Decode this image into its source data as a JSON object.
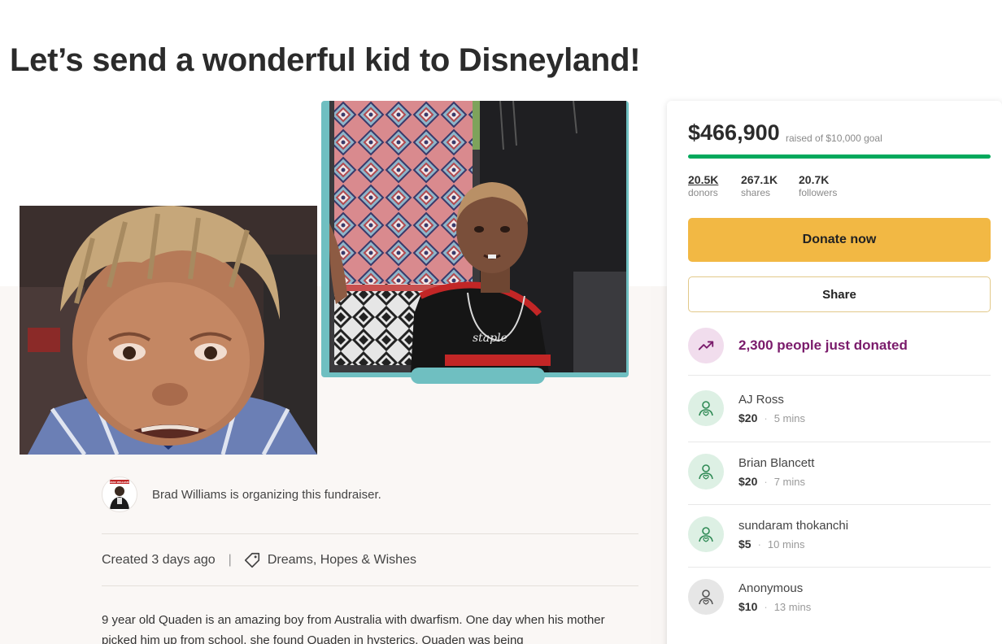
{
  "page": {
    "title": "Let’s send a wonderful kid to Disneyland!"
  },
  "organizer": {
    "avatar_lettering": "BRAD WILLIAMS",
    "text": "Brad Williams is organizing this fundraiser."
  },
  "meta": {
    "created": "Created 3 days ago",
    "separator": "|",
    "category": "Dreams, Hopes & Wishes"
  },
  "story": {
    "text": "9 year old Quaden is an amazing boy from Australia with dwarfism. One day when his mother picked him up from school, she found Quaden in hysterics. Quaden was being"
  },
  "photos": {
    "shirt_lettering": "staple"
  },
  "sidebar": {
    "raised": "$466,900",
    "goal_text": "raised of $10,000 goal",
    "progress_fraction": 1.0,
    "stats": [
      {
        "value": "20.5K",
        "label": "donors"
      },
      {
        "value": "267.1K",
        "label": "shares"
      },
      {
        "value": "20.7K",
        "label": "followers"
      }
    ],
    "donate_label": "Donate now",
    "share_label": "Share",
    "trend_text": "2,300 people just donated",
    "donations": [
      {
        "name": "AJ Ross",
        "amount": "$20",
        "time": "5 mins",
        "icon": "donor-heart-icon"
      },
      {
        "name": "Brian Blancett",
        "amount": "$20",
        "time": "7 mins",
        "icon": "donor-heart-icon"
      },
      {
        "name": "sundaram thokanchi",
        "amount": "$5",
        "time": "10 mins",
        "icon": "donor-heart-icon"
      },
      {
        "name": "Anonymous",
        "amount": "$10",
        "time": "13 mins",
        "icon": "donor-heart-icon"
      }
    ]
  },
  "colors": {
    "progress": "#02a95c",
    "donate_button": "#f2b844",
    "trend_text": "#7a1b6b",
    "photo_frame": "#6fbfc1"
  }
}
